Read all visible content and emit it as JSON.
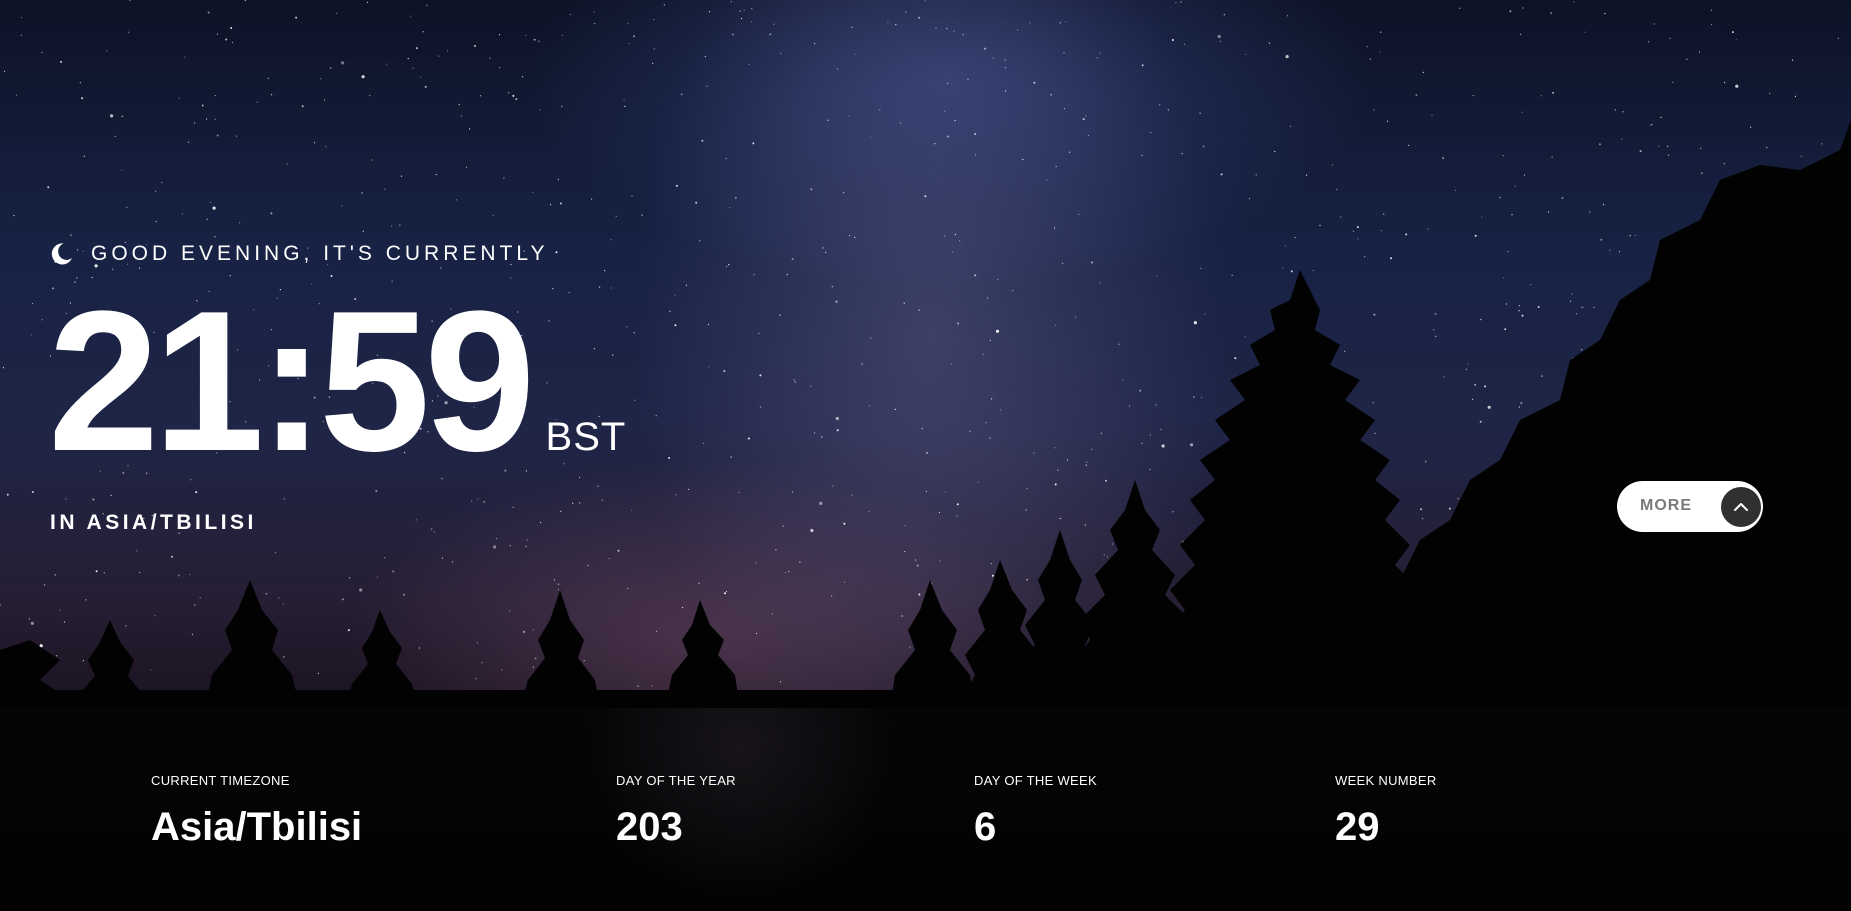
{
  "greeting": {
    "icon": "moon-icon",
    "text": "GOOD EVENING, IT'S CURRENTLY"
  },
  "clock": {
    "time": "21:59",
    "abbreviation": "BST"
  },
  "location": {
    "text": "IN ASIA/TBILISI"
  },
  "more_button": {
    "label": "MORE",
    "icon": "chevron-up-icon"
  },
  "info": [
    {
      "label": "CURRENT TIMEZONE",
      "value": "Asia/Tbilisi"
    },
    {
      "label": "DAY OF THE YEAR",
      "value": "203"
    },
    {
      "label": "DAY OF THE WEEK",
      "value": "6"
    },
    {
      "label": "WEEK NUMBER",
      "value": "29"
    }
  ],
  "colors": {
    "panel_background": "#030304",
    "button_background": "#ffffff",
    "button_text": "#7a7a7a",
    "chevron_background": "#303030",
    "text": "#ffffff"
  }
}
